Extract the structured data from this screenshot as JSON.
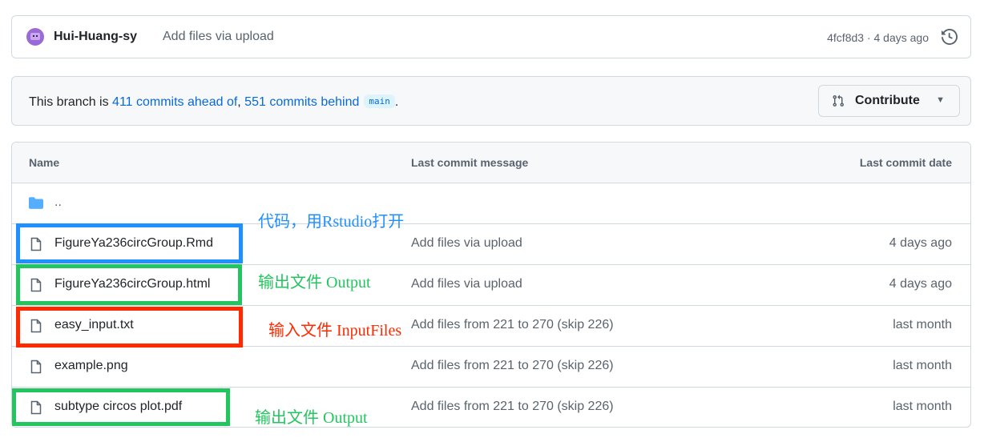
{
  "commit": {
    "author": "Hui-Huang-sy",
    "message": "Add files via upload",
    "meta": "4fcf8d3 · 4 days ago",
    "history_icon": "history-icon"
  },
  "branch": {
    "prefix": "This branch is ",
    "ahead": "411 commits ahead of",
    "sep": ", ",
    "behind": "551 commits behind",
    "base": "main",
    "suffix": ".",
    "contribute_label": "Contribute",
    "contribute_icon": "git-pull-request-icon"
  },
  "table": {
    "headers": {
      "name": "Name",
      "message": "Last commit message",
      "date": "Last commit date"
    },
    "parent_dir": "..",
    "rows": [
      {
        "name": "FigureYa236circGroup.Rmd",
        "message": "Add files via upload",
        "date": "4 days ago"
      },
      {
        "name": "FigureYa236circGroup.html",
        "message": "Add files via upload",
        "date": "4 days ago"
      },
      {
        "name": "easy_input.txt",
        "message": "Add files from 221 to 270 (skip 226)",
        "date": "last month"
      },
      {
        "name": "example.png",
        "message": "Add files from 221 to 270 (skip 226)",
        "date": "last month"
      },
      {
        "name": "subtype circos plot.pdf",
        "message": "Add files from 221 to 270 (skip 226)",
        "date": "last month"
      }
    ]
  },
  "annotations": {
    "code": "代码，用Rstudio打开",
    "output_html": "输出文件 Output",
    "input": "输入文件 InputFiles",
    "output_pdf": "输出文件 Output"
  },
  "colors": {
    "link": "#0969da",
    "annotation_blue": "#1e90ff",
    "annotation_green": "#22c55e",
    "annotation_red": "#ff2a00"
  }
}
